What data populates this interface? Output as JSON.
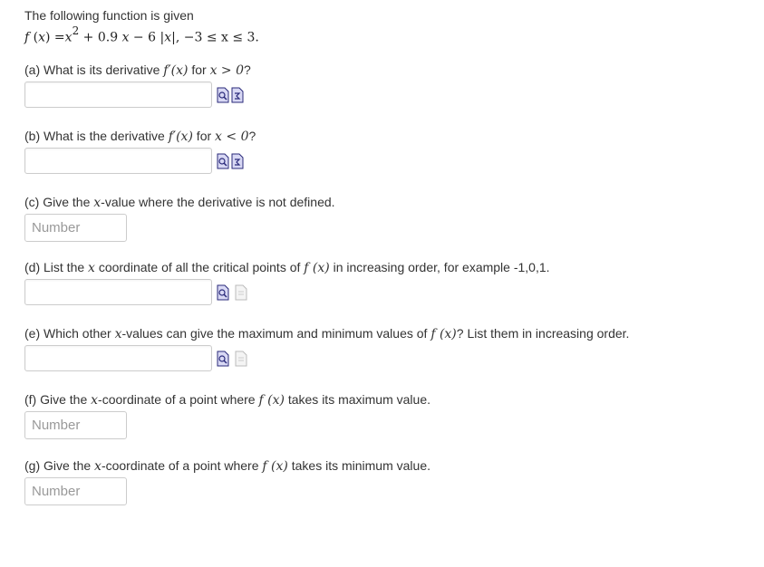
{
  "intro": {
    "text": "The following function is given",
    "formula_tail": ", −3 ≤ x ≤ 3."
  },
  "questions": {
    "a": {
      "text_pre": "(a) What is its derivative ",
      "math_fx": "f′(x)",
      "text_mid": " for ",
      "cond": "x > 0",
      "text_post": "?"
    },
    "b": {
      "text_pre": "(b) What is the derivative ",
      "math_fx": "f′(x)",
      "text_mid": " for ",
      "cond": "x < 0",
      "text_post": "?"
    },
    "c": {
      "text_pre": "(c) Give the ",
      "math_x": "x",
      "text_post": "-value where the derivative is not defined.",
      "placeholder": "Number"
    },
    "d": {
      "text_pre": "(d) List the ",
      "math_x": "x",
      "text_mid": " coordinate of all the critical points of ",
      "math_fx": "f (x)",
      "text_post": " in increasing order, for example -1,0,1."
    },
    "e": {
      "text_pre": "(e) Which other ",
      "math_x": "x",
      "text_mid": "-values can give the maximum and minimum values of ",
      "math_fx": "f (x)",
      "text_post": "? List them in increasing order."
    },
    "f": {
      "text_pre": "(f) Give the ",
      "math_x": "x",
      "text_mid": "-coordinate of a point where ",
      "math_fx": "f (x)",
      "text_post": " takes its maximum value.",
      "placeholder": "Number"
    },
    "g": {
      "text_pre": "(g) Give the ",
      "math_x": "x",
      "text_mid": "-coordinate of a point where ",
      "math_fx": "f (x)",
      "text_post": " takes its minimum value.",
      "placeholder": "Number"
    }
  },
  "icons": {
    "preview": "preview-icon",
    "equation_editor": "equation-editor-icon"
  },
  "colors": {
    "icon_blue": "#3b3b8f",
    "icon_fill": "#c9c9f0",
    "border": "#cccccc",
    "placeholder": "#999999"
  }
}
